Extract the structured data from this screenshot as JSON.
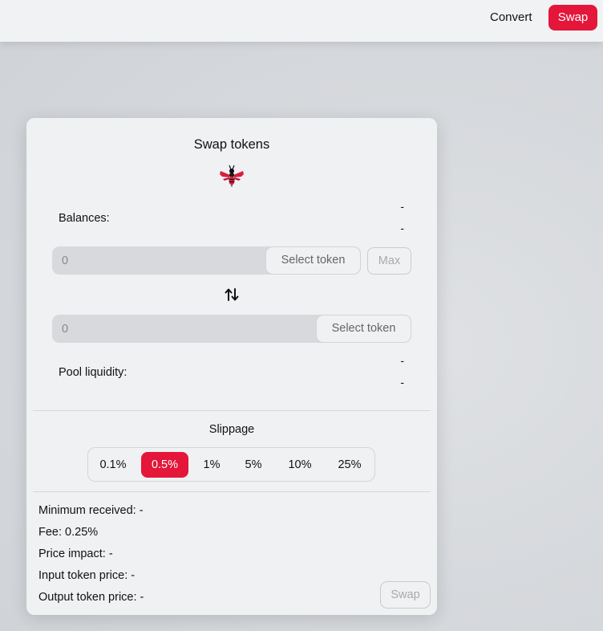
{
  "nav": {
    "convert_label": "Convert",
    "swap_label": "Swap"
  },
  "card": {
    "title": "Swap tokens",
    "logo_icon": "bee-logo-icon",
    "balances": {
      "label": "Balances:",
      "values": [
        "-",
        "-"
      ]
    },
    "from": {
      "placeholder": "0",
      "select_label": "Select token",
      "max_label": "Max"
    },
    "switch_icon": "swap-arrows-icon",
    "to": {
      "placeholder": "0",
      "select_label": "Select token"
    },
    "pool_liquidity": {
      "label": "Pool liquidity:",
      "values": [
        "-",
        "-"
      ]
    },
    "slippage": {
      "title": "Slippage",
      "options": [
        "0.1%",
        "0.5%",
        "1%",
        "5%",
        "10%",
        "25%"
      ],
      "selected": "0.5%"
    },
    "info": {
      "minimum_received": "Minimum received: -",
      "fee": "Fee: 0.25%",
      "price_impact": "Price impact: -",
      "input_token_price": "Input token price: -",
      "output_token_price": "Output token price: -"
    },
    "swap_button_label": "Swap"
  },
  "colors": {
    "accent": "#e4163a",
    "card_bg": "#f0f1f2",
    "page_bg": "#d5d8dc"
  }
}
